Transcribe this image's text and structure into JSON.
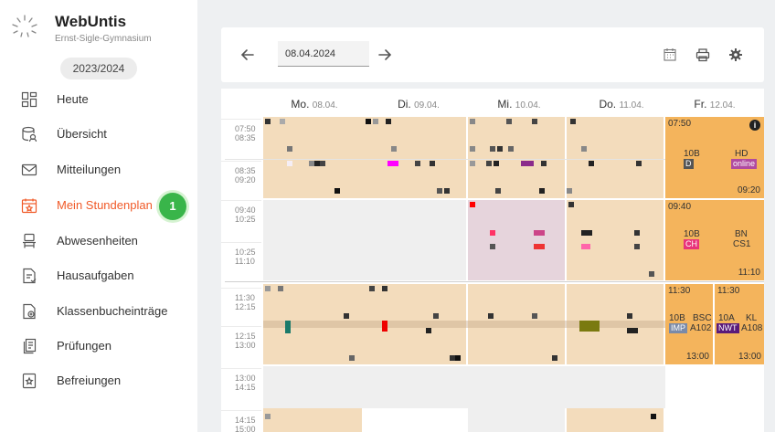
{
  "app": {
    "title": "WebUntis",
    "school": "Ernst-Sigle-Gymnasium",
    "year": "2023/2024"
  },
  "sidebar": {
    "items": [
      {
        "label": "Heute",
        "icon": "dashboard-icon"
      },
      {
        "label": "Übersicht",
        "icon": "overview-icon"
      },
      {
        "label": "Mitteilungen",
        "icon": "mail-icon"
      },
      {
        "label": "Mein Stundenplan",
        "icon": "calendar-icon",
        "active": true
      },
      {
        "label": "Abwesenheiten",
        "icon": "absence-icon"
      },
      {
        "label": "Hausaufgaben",
        "icon": "homework-icon"
      },
      {
        "label": "Klassenbucheinträge",
        "icon": "classbook-icon"
      },
      {
        "label": "Prüfungen",
        "icon": "exams-icon"
      },
      {
        "label": "Befreiungen",
        "icon": "exemption-icon"
      }
    ],
    "badge": "1"
  },
  "toolbar": {
    "date": "08.04.2024"
  },
  "days": [
    {
      "name": "Mo.",
      "date": "08.04."
    },
    {
      "name": "Di.",
      "date": "09.04."
    },
    {
      "name": "Mi.",
      "date": "10.04."
    },
    {
      "name": "Do.",
      "date": "11.04."
    },
    {
      "name": "Fr.",
      "date": "12.04."
    }
  ],
  "times": [
    {
      "start": "07:50",
      "end": "08:35"
    },
    {
      "start": "08:35",
      "end": "09:20"
    },
    {
      "start": "09:40",
      "end": "10:25"
    },
    {
      "start": "10:25",
      "end": "11:10"
    },
    {
      "start": "11:30",
      "end": "12:15"
    },
    {
      "start": "12:15",
      "end": "13:00"
    },
    {
      "start": "13:00",
      "end": "14:15"
    },
    {
      "start": "14:15",
      "end": "15:00"
    }
  ],
  "friday": {
    "lesson1": {
      "start": "07:50",
      "end": "09:20",
      "class": "10B",
      "subject": "D",
      "teacher": "HD",
      "room": "online",
      "info": "i"
    },
    "lesson2": {
      "start": "09:40",
      "end": "11:10",
      "class": "10B",
      "subject": "CH",
      "teacher": "BN",
      "room": "CS1"
    },
    "lesson3a": {
      "start": "11:30",
      "end": "13:00",
      "class": "10B",
      "teacher": "BSC",
      "subject": "IMP",
      "room": "A102"
    },
    "lesson3b": {
      "start": "11:30",
      "end": "13:00",
      "class": "10A",
      "teacher": "KL",
      "subject": "NWT",
      "room": "A108"
    }
  },
  "colors": {
    "accent": "#f05a28",
    "badge": "#39b54a",
    "lesson_tan": "#f3dcbc",
    "lesson_orange": "#f4b45c"
  }
}
